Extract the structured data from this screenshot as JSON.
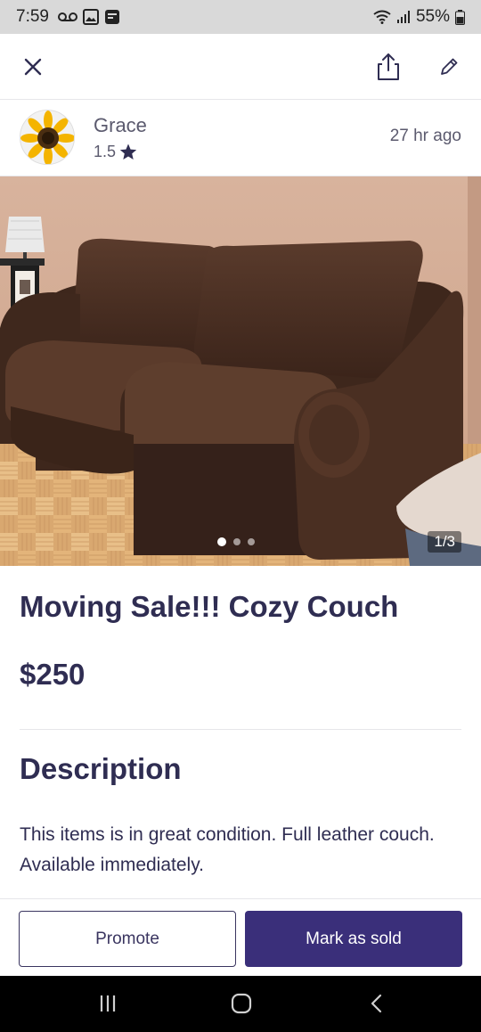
{
  "status_bar": {
    "time": "7:59",
    "battery": "55%",
    "left_icons": [
      "voicemail-icon",
      "gallery-icon",
      "app-notification-icon"
    ],
    "right_icons": [
      "wifi-icon",
      "signal-icon",
      "battery-icon"
    ]
  },
  "toolbar": {
    "icons": [
      "close-icon",
      "share-icon",
      "edit-pencil-icon"
    ]
  },
  "seller": {
    "name": "Grace",
    "rating": "1.5",
    "posted": "27 hr  ago",
    "avatar": "sunflower-avatar"
  },
  "photo": {
    "counter": "1/3",
    "dots": 3,
    "active_dot": 1
  },
  "listing": {
    "title": "Moving Sale!!! Cozy Couch",
    "price": "$250",
    "description_heading": "Description",
    "description": "This items is in great condition. Full leather couch. Available immediately."
  },
  "actions": {
    "promote_label": "Promote",
    "sold_label": "Mark as sold"
  },
  "colors": {
    "primary": "#3a2f7a",
    "text": "#2f2d52",
    "muted": "#5b5a6e"
  },
  "nav_bar": {
    "buttons": [
      "recents-icon",
      "home-icon",
      "back-icon"
    ]
  }
}
